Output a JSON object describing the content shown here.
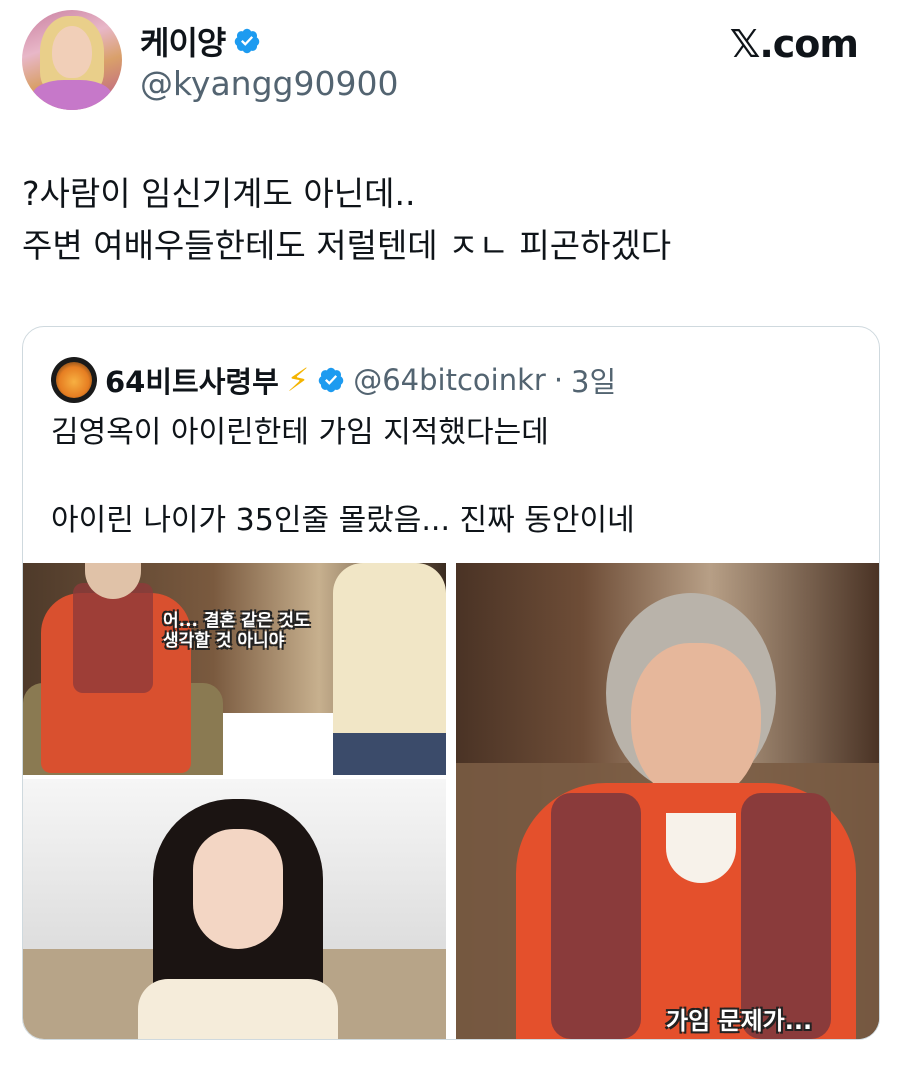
{
  "author": {
    "display_name": "케이양",
    "handle": "@kyangg90900"
  },
  "brand": "𝕏.com",
  "tweet": {
    "lines": [
      "?사람이 임신기계도 아닌데..",
      "주변 여배우들한테도 저럴텐데 ㅈㄴ 피곤하겠다"
    ]
  },
  "quoted": {
    "display_name": "64비트사령부",
    "bolt": "⚡",
    "handle": "@64bitcoinkr",
    "separator": "·",
    "time": "3일",
    "lines": [
      "김영옥이 아이린한테 가임 지적했다는데",
      "",
      "아이린 나이가 35인줄 몰랐음... 진짜 동안이네"
    ],
    "captions": {
      "img1_line1": "어... 결혼 같은 것도",
      "img1_line2": "생각할 것 아니야",
      "img3": "가임 문제가..."
    }
  },
  "icons": {
    "verified": "verified-badge-icon",
    "lightning": "lightning-icon"
  },
  "colors": {
    "verified_blue": "#1d9bf0",
    "secondary_text": "#536471",
    "border": "#cfd9de"
  }
}
